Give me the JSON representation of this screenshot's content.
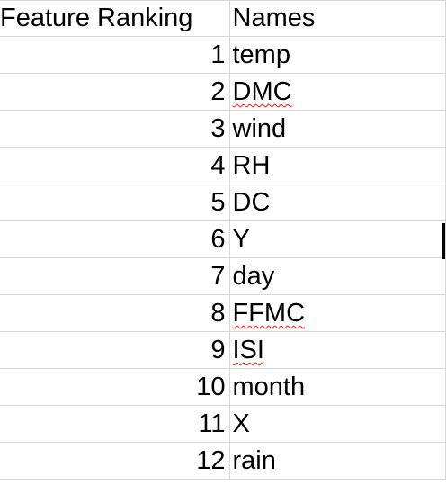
{
  "headers": {
    "col1": "Feature Ranking",
    "col2": "Names"
  },
  "rows": [
    {
      "rank": "1",
      "name": "temp",
      "spellcheck": false
    },
    {
      "rank": "2",
      "name": "DMC",
      "spellcheck": true
    },
    {
      "rank": "3",
      "name": "wind",
      "spellcheck": false
    },
    {
      "rank": "4",
      "name": "RH",
      "spellcheck": false
    },
    {
      "rank": "5",
      "name": "DC",
      "spellcheck": false
    },
    {
      "rank": "6",
      "name": "Y",
      "spellcheck": false
    },
    {
      "rank": "7",
      "name": "day",
      "spellcheck": false
    },
    {
      "rank": "8",
      "name": "FFMC",
      "spellcheck": true
    },
    {
      "rank": "9",
      "name": "ISI",
      "spellcheck": true
    },
    {
      "rank": "10",
      "name": "month",
      "spellcheck": false
    },
    {
      "rank": "11",
      "name": "X",
      "spellcheck": false
    },
    {
      "rank": "12",
      "name": "rain",
      "spellcheck": false
    }
  ],
  "colors": {
    "gridline": "#d6d6d6",
    "spellcheck_underline": "#e02020",
    "text": "#000000"
  }
}
